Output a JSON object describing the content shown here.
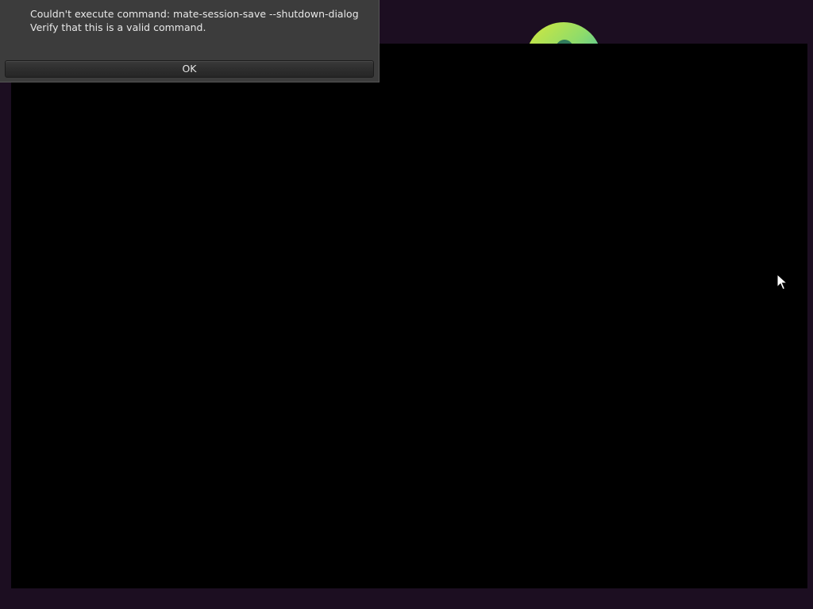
{
  "dialog": {
    "message_line1": "Couldn't execute command: mate-session-save --shutdown-dialog",
    "message_line2": "Verify that this is a valid command.",
    "ok_label": "OK"
  },
  "desktop": {
    "background_color": "#1c0e21",
    "window_color": "#000000"
  },
  "icons": {
    "wallpaper": "ubuntu-mate-logo-icon",
    "pointer": "mouse-pointer-icon"
  }
}
